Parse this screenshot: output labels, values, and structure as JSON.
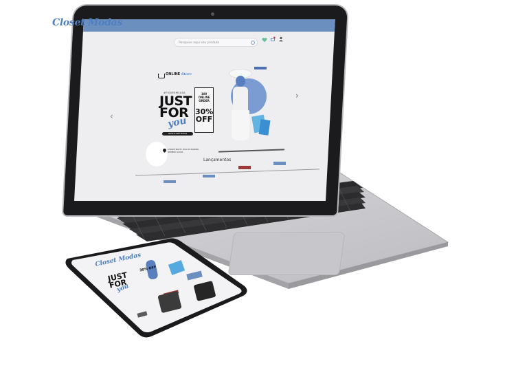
{
  "store": {
    "logo_text": "Closet Modas",
    "search_placeholder": "Pesquise aqui seu produto",
    "header_icons": [
      {
        "name": "heart-icon",
        "label": ""
      },
      {
        "name": "cart-icon",
        "label": ""
      },
      {
        "name": "user-icon",
        "label": ""
      }
    ]
  },
  "hero": {
    "online_label": "ONLINE",
    "online_script": "Store",
    "kicker": "#FIQUEEMCASA",
    "headline_line1": "JUST",
    "headline_line2": "FOR",
    "headline_script": "you",
    "shop_button": "WWW.CLOSET.MODAS",
    "offer_line1": "100 ONLINE ORDER",
    "offer_line2": "30% OFF",
    "address": "CIDADE RIGHT, RUA DO BAIRRO, NÚMERO 12345",
    "prev_arrow": "‹",
    "next_arrow": "›"
  },
  "section": {
    "title": "Lançamentos"
  },
  "phone": {
    "logo_text": "Closet Modas",
    "headline_line1": "JUST",
    "headline_line2": "FOR",
    "headline_script": "you",
    "offer": "30% OFF"
  },
  "colors": {
    "brand_blue": "#4f7fc0",
    "topbar": "#6b8fbf",
    "accent_red": "#9c3838",
    "accent_tab_blue": "#4f6fb5"
  }
}
